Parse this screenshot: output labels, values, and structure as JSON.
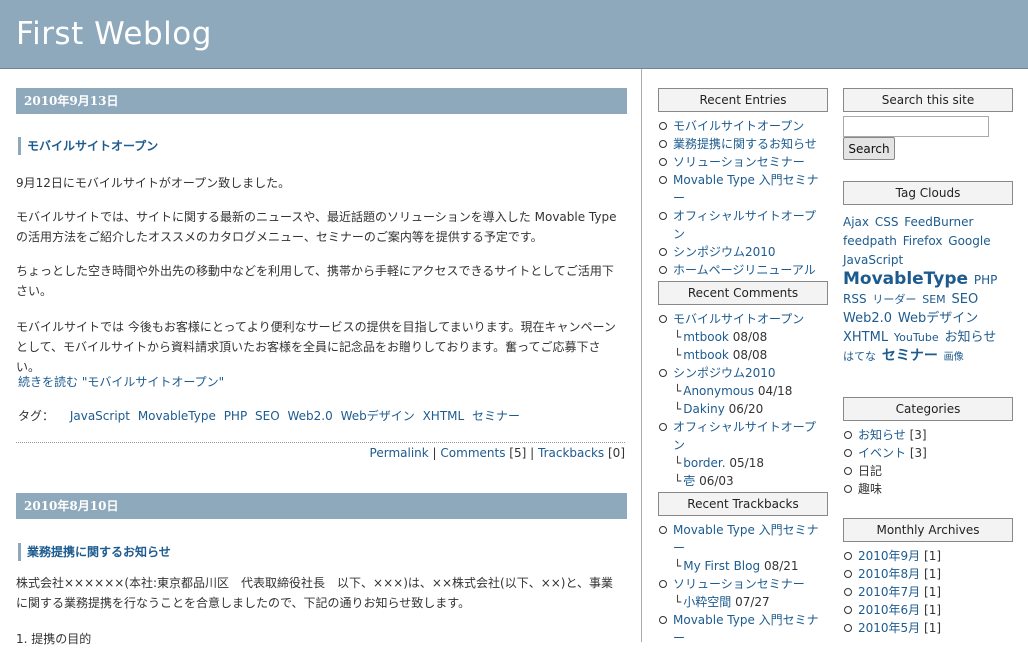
{
  "site": {
    "title": "First Weblog"
  },
  "entries": [
    {
      "date": "2010年9月13日",
      "title": "モバイルサイトオープン",
      "paragraphs": [
        "9月12日にモバイルサイトがオープン致しました。",
        "モバイルサイトでは、サイトに関する最新のニュースや、最近話題のソリューションを導入した Movable Type の活用方法をご紹介したオススメのカタログメニュー、セミナーのご案内等を提供する予定です。",
        "ちょっとした空き時間や外出先の移動中などを利用して、携帯から手軽にアクセスできるサイトとしてご活用下さい。",
        "モバイルサイトでは 今後もお客様にとってより便利なサービスの提供を目指してまいります。現在キャンペーンとして、モバイルサイトから資料請求頂いたお客様を全員に記念品をお贈りしております。奮ってご応募下さい。"
      ],
      "more_link": "続きを読む \"モバイルサイトオープン\"",
      "tags_label": "タグ：",
      "tags": [
        "JavaScript",
        "MovableType",
        "PHP",
        "SEO",
        "Web2.0",
        "Webデザイン",
        "XHTML",
        "セミナー"
      ],
      "permalink": "Permalink",
      "comments": "Comments",
      "comments_count": "[5]",
      "trackbacks": "Trackbacks",
      "trackbacks_count": "[0]",
      "sep": "|"
    },
    {
      "date": "2010年8月10日",
      "title": "業務提携に関するお知らせ",
      "paragraphs": [
        "株式会社××××××(本社:東京都品川区　代表取締役社長　以下、×××)は、××株式会社(以下、××)と、事業に関する業務提携を行なうことを合意しましたので、下記の通りお知らせ致します。",
        "1. 提携の目的"
      ]
    }
  ],
  "recent_entries": {
    "title": "Recent Entries",
    "items": [
      "モバイルサイトオープン",
      "業務提携に関するお知らせ",
      "ソリューションセミナー",
      "Movable Type 入門セミナー",
      "オフィシャルサイトオープン",
      "シンポジウム2010",
      "ホームページリニューアル"
    ]
  },
  "recent_comments": {
    "title": "Recent Comments",
    "groups": [
      {
        "entry": "モバイルサイトオープン",
        "comments": [
          {
            "author": "mtbook",
            "date": "08/08"
          },
          {
            "author": "mtbook",
            "date": "08/08"
          }
        ]
      },
      {
        "entry": "シンポジウム2010",
        "comments": [
          {
            "author": "Anonymous",
            "date": "04/18"
          },
          {
            "author": "Dakiny",
            "date": "06/20"
          }
        ]
      },
      {
        "entry": "オフィシャルサイトオープン",
        "comments": [
          {
            "author": "border.",
            "date": "05/18"
          },
          {
            "author": "壱",
            "date": "06/03"
          }
        ]
      }
    ]
  },
  "recent_trackbacks": {
    "title": "Recent Trackbacks",
    "groups": [
      {
        "entry": "Movable Type 入門セミナー",
        "tb": {
          "author": "My First Blog",
          "date": "08/21"
        }
      },
      {
        "entry": "ソリューションセミナー",
        "tb": {
          "author": "小粋空間",
          "date": "07/27"
        }
      },
      {
        "entry": "Movable Type 入門セミナー"
      }
    ]
  },
  "search": {
    "title": "Search this site",
    "button": "Search",
    "value": ""
  },
  "tag_clouds": {
    "title": "Tag Clouds",
    "tags": [
      {
        "name": "Ajax",
        "size": 12
      },
      {
        "name": "CSS",
        "size": 12
      },
      {
        "name": "FeedBurner",
        "size": 12
      },
      {
        "name": "feedpath",
        "size": 12
      },
      {
        "name": "Firefox",
        "size": 12
      },
      {
        "name": "Google",
        "size": 12
      },
      {
        "name": "JavaScript",
        "size": 12
      },
      {
        "name": "MovableType",
        "size": 17
      },
      {
        "name": "PHP",
        "size": 12
      },
      {
        "name": "RSS",
        "size": 12
      },
      {
        "name": "リーダー",
        "size": 11
      },
      {
        "name": "SEM",
        "size": 11
      },
      {
        "name": "SEO",
        "size": 13
      },
      {
        "name": "Web2.0",
        "size": 13
      },
      {
        "name": "Webデザイン",
        "size": 13
      },
      {
        "name": "XHTML",
        "size": 13
      },
      {
        "name": "YouTube",
        "size": 11
      },
      {
        "name": "お知らせ",
        "size": 13
      },
      {
        "name": "はてな",
        "size": 11
      },
      {
        "name": "セミナー",
        "size": 14
      },
      {
        "name": "画像",
        "size": 10
      }
    ]
  },
  "categories": {
    "title": "Categories",
    "items": [
      {
        "name": "お知らせ",
        "count": "[3]",
        "link": true
      },
      {
        "name": "イベント",
        "count": "[3]",
        "link": true
      },
      {
        "name": "日記",
        "count": "",
        "link": false
      },
      {
        "name": "趣味",
        "count": "",
        "link": false
      }
    ]
  },
  "monthly_archives": {
    "title": "Monthly Archives",
    "items": [
      {
        "name": "2010年9月",
        "count": "[1]"
      },
      {
        "name": "2010年8月",
        "count": "[1]"
      },
      {
        "name": "2010年7月",
        "count": "[1]"
      },
      {
        "name": "2010年6月",
        "count": "[1]"
      },
      {
        "name": "2010年5月",
        "count": "[1]"
      }
    ]
  }
}
